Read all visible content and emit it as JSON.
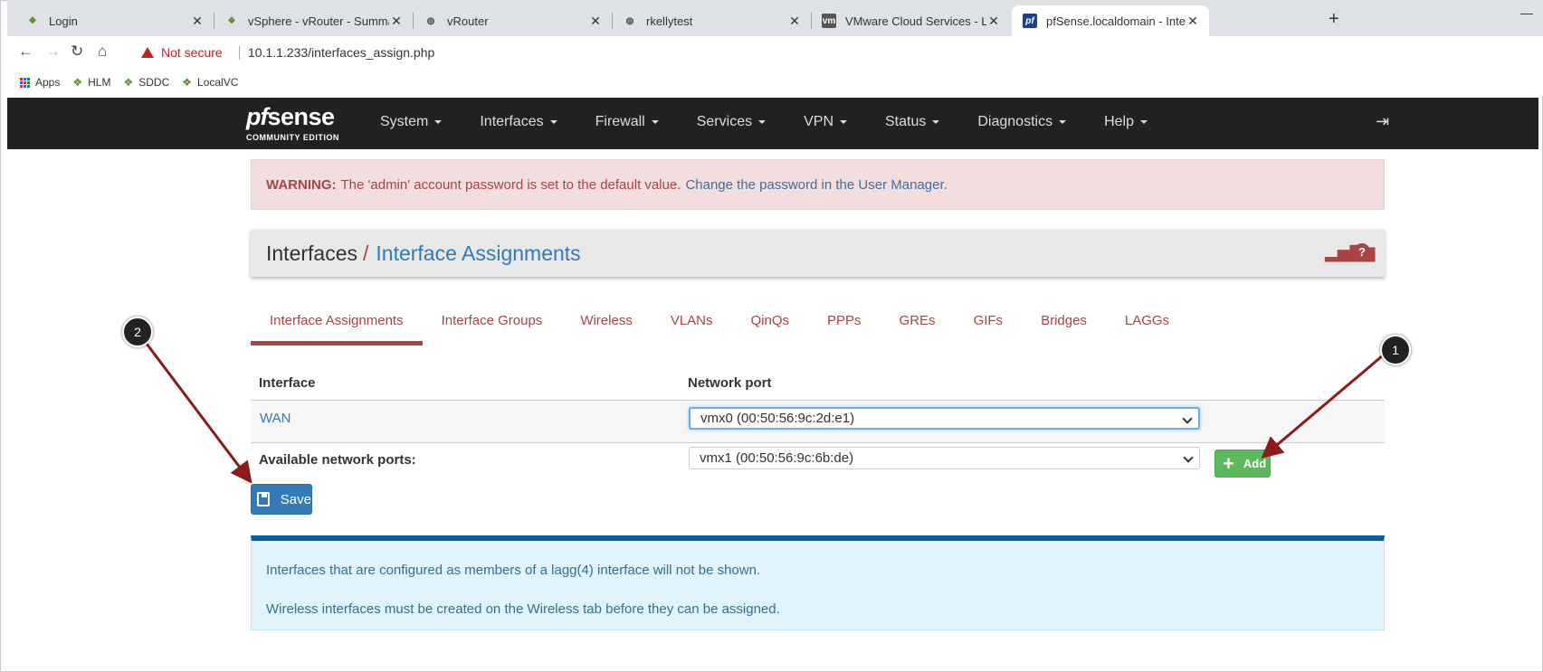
{
  "browser": {
    "tabs": [
      {
        "title": "Login",
        "icon": "vsphere-icon"
      },
      {
        "title": "vSphere - vRouter - Summary",
        "icon": "vsphere-icon"
      },
      {
        "title": "vRouter",
        "icon": "globe-icon"
      },
      {
        "title": "rkellytest",
        "icon": "globe-icon"
      },
      {
        "title": "VMware Cloud Services - Log In",
        "icon": "vmware-icon"
      },
      {
        "title": "pfSense.localdomain - Interfaces",
        "icon": "pfsense-icon"
      }
    ],
    "close_glyph": "✕",
    "new_tab": "+",
    "minimize": "—",
    "security_label": "Not secure",
    "url": "10.1.1.233/interfaces_assign.php",
    "bookmarks": [
      "Apps",
      "HLM",
      "SDDC",
      "LocalVC"
    ]
  },
  "navbar": {
    "logo_pf": "pf",
    "logo_sense": "sense",
    "logo_edition": "COMMUNITY EDITION",
    "menu": [
      "System",
      "Interfaces",
      "Firewall",
      "Services",
      "VPN",
      "Status",
      "Diagnostics",
      "Help"
    ]
  },
  "alert": {
    "label": "WARNING:",
    "text": "The 'admin' account password is set to the default value.",
    "link": "Change the password in the User Manager."
  },
  "breadcrumb": {
    "parent": "Interfaces",
    "separator": "/",
    "current": "Interface Assignments"
  },
  "tabs": [
    "Interface Assignments",
    "Interface Groups",
    "Wireless",
    "VLANs",
    "QinQs",
    "PPPs",
    "GREs",
    "GIFs",
    "Bridges",
    "LAGGs"
  ],
  "table": {
    "headers": [
      "Interface",
      "Network port"
    ],
    "rows": [
      {
        "interface": "WAN",
        "port": "vmx0 (00:50:56:9c:2d:e1)"
      }
    ],
    "available_label": "Available network ports:",
    "available_value": "vmx1 (00:50:56:9c:6b:de)",
    "add_label": "Add"
  },
  "save_label": "Save",
  "info": {
    "line1": "Interfaces that are configured as members of a lagg(4) interface will not be shown.",
    "line2": "Wireless interfaces must be created on the Wireless tab before they can be assigned."
  },
  "callouts": [
    "1",
    "2"
  ],
  "colors": {
    "accent_red": "#a94442",
    "link_blue": "#337ab7",
    "add_green": "#5cb85c",
    "navbar": "#212121"
  }
}
